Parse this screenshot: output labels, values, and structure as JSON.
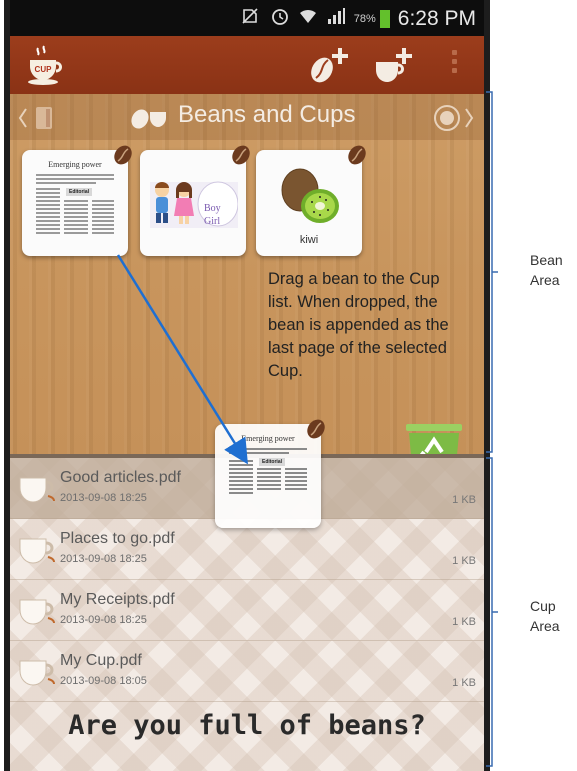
{
  "status_bar": {
    "battery_percent": "78%",
    "time": "6:28 PM"
  },
  "action_bar": {
    "app_icon_label": "CUP",
    "add_bean_icon": "add-bean-icon",
    "add_cup_icon": "add-cup-icon",
    "overflow_icon": "overflow-menu-icon"
  },
  "bean_area": {
    "title": "Beans and Cups",
    "beans": [
      {
        "kind": "document",
        "title": "Emerging power",
        "section": "Editorial"
      },
      {
        "kind": "image",
        "caption_lines": [
          "Boy",
          "Girl"
        ]
      },
      {
        "kind": "image",
        "caption": "kiwi"
      }
    ],
    "hint": "Drag a bean to the Cup list.  When dropped, the bean is appended as the last page of the selected Cup."
  },
  "dragged_bean": {
    "title": "Emerging power",
    "section": "Editorial"
  },
  "cups": [
    {
      "name": "Good articles.pdf",
      "date": "2013-09-08 18:25",
      "size": "1 KB",
      "selected": true
    },
    {
      "name": "Places to go.pdf",
      "date": "2013-09-08 18:25",
      "size": "1 KB",
      "selected": false
    },
    {
      "name": "My Receipts.pdf",
      "date": "2013-09-08 18:25",
      "size": "1 KB",
      "selected": false
    },
    {
      "name": "My Cup.pdf",
      "date": "2013-09-08 18:05",
      "size": "1 KB",
      "selected": false
    }
  ],
  "footer": "Are you full of beans?",
  "annotations": {
    "bean_area_line1": "Bean",
    "bean_area_line2": "Area",
    "cup_area_line1": "Cup",
    "cup_area_line2": "Area"
  },
  "colors": {
    "action_bar": "#9c3d1c",
    "wood": "#c7935a",
    "arrow": "#1f6fd1",
    "trash": "#7dbb45"
  }
}
